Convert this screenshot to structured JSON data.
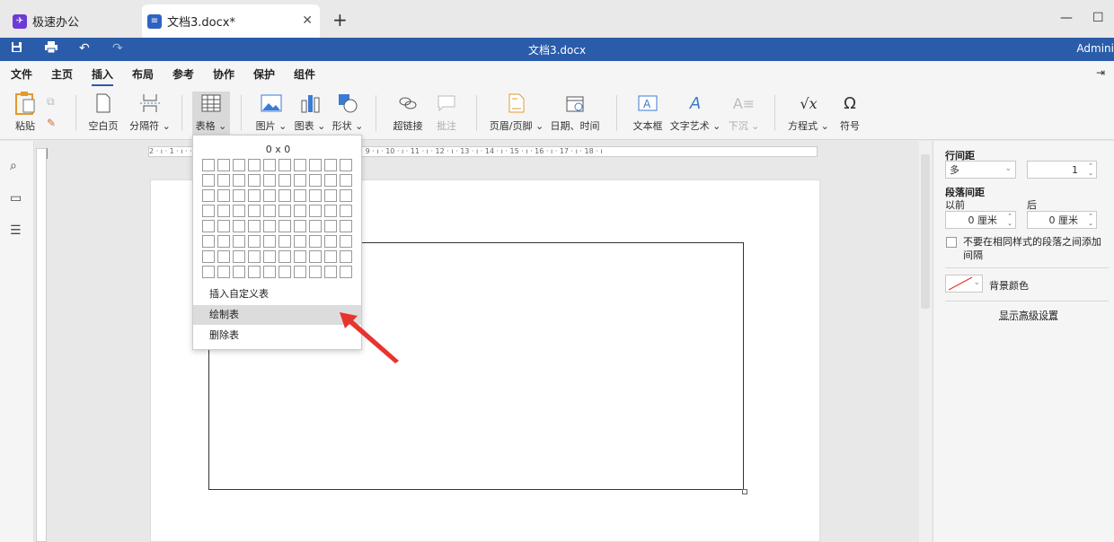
{
  "tabs": {
    "app_title": "极速办公",
    "doc_title": "文档3.docx*"
  },
  "titlebar": {
    "doc_name": "文档3.docx",
    "user": "Admini"
  },
  "menu": {
    "items": [
      "文件",
      "主页",
      "插入",
      "布局",
      "参考",
      "协作",
      "保护",
      "组件"
    ],
    "active": "插入"
  },
  "ribbon": {
    "paste": "粘贴",
    "blank_page": "空白页",
    "section_break": "分隔符",
    "table": "表格",
    "image": "图片",
    "chart": "图表",
    "shape": "形状",
    "hyperlink": "超链接",
    "comment": "批注",
    "header_footer": "页眉/页脚",
    "date_time": "日期、时间",
    "text_box": "文本框",
    "text_art": "文字艺术",
    "drop_cap": "下沉",
    "equation": "方程式",
    "symbol": "符号"
  },
  "ruler": {
    "corner": "L",
    "ticks": "2 · ı · 1 · ı ·   · ı · 1 · ı · 2 · ı · 3 · ı · 4 · ı · 5 · ı · 6 · ı · 7 · ı · 8 · ı · 9 · ı · 10 · ı · 11 · ı · 12 · ı · 13 · ı · 14 · ı · 15 · ı · 16 · ı · 17 · ı · 18 · ı"
  },
  "table_dropdown": {
    "size_label": "0 x 0",
    "grid_rows": 8,
    "grid_cols": 10,
    "items": [
      "插入自定义表",
      "绘制表",
      "删除表"
    ],
    "highlighted": "绘制表"
  },
  "right_panel": {
    "line_spacing_label": "行间距",
    "line_spacing_type": "多",
    "line_spacing_value": "1",
    "para_spacing_label": "段落间距",
    "before_label": "以前",
    "after_label": "后",
    "before_value": "0 厘米",
    "after_value": "0 厘米",
    "no_space_same_style": "不要在相同样式的段落之间添加间隔",
    "bg_color_label": "背景颜色",
    "advanced_link": "显示高级设置"
  },
  "colors": {
    "accent": "#2a5caa",
    "annotation_arrow": "#e8332f"
  }
}
